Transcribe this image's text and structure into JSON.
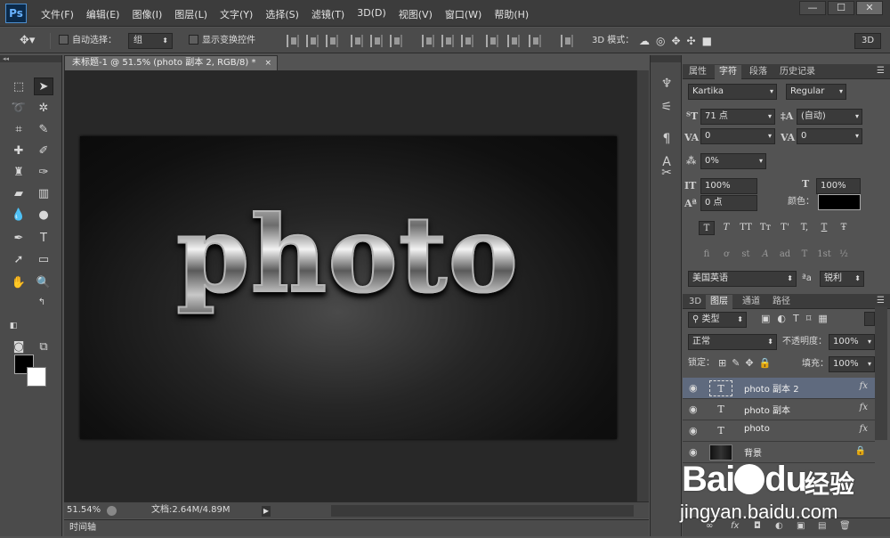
{
  "app": {
    "logo": "Ps",
    "menus": [
      "文件(F)",
      "编辑(E)",
      "图像(I)",
      "图层(L)",
      "文字(Y)",
      "选择(S)",
      "滤镜(T)",
      "3D(D)",
      "视图(V)",
      "窗口(W)",
      "帮助(H)"
    ],
    "window_controls": [
      "—",
      "☐",
      "✕"
    ]
  },
  "options_bar": {
    "auto_select_label": "自动选择：",
    "auto_select_value": "组",
    "show_transform_label": "显示变换控件",
    "mode_3d_label": "3D 模式：",
    "btn_3d": "3D"
  },
  "document": {
    "tab_title": "未标题-1 @ 51.5% (photo 副本 2, RGB/8) *",
    "close": "×",
    "canvas_text": "photo",
    "zoom": "51.54%",
    "doc_info": "文档:2.64M/4.89M",
    "status_arrow": "▶",
    "timeline_label": "时间轴"
  },
  "character_panel": {
    "tabs": [
      "属性",
      "字符",
      "段落",
      "历史记录"
    ],
    "active_tab": "字符",
    "font_family": "Kartika",
    "font_style": "Regular",
    "font_size": "71 点",
    "leading": "(自动)",
    "kerning": "0",
    "tracking": "0",
    "tsume": "0%",
    "vertical_scale": "100%",
    "horizontal_scale": "100%",
    "baseline_shift": "0 点",
    "color_label": "颜色：",
    "color_value": "#000000",
    "style_buttons": [
      "T",
      "T",
      "TT",
      "Tт",
      "T'",
      "T,",
      "T",
      "Ŧ"
    ],
    "opentype_buttons": [
      "fi",
      "ơ",
      "st",
      "A",
      "ad",
      "T",
      "1st",
      "½"
    ],
    "language": "美国英语",
    "aa_icon": "ªa",
    "antialias": "锐利"
  },
  "layers_panel": {
    "tabs": [
      "3D",
      "图层",
      "通道",
      "路径"
    ],
    "active_tab": "图层",
    "filter_kind": "类型",
    "blend_mode": "正常",
    "opacity_label": "不透明度：",
    "opacity_value": "100%",
    "lock_label": "锁定：",
    "fill_label": "填充：",
    "fill_value": "100%",
    "layers": [
      {
        "name": "photo 副本 2",
        "type": "T",
        "fx": "fx",
        "selected": true
      },
      {
        "name": "photo 副本",
        "type": "T",
        "fx": "fx",
        "selected": false
      },
      {
        "name": "photo",
        "type": "T",
        "fx": "fx",
        "selected": false
      },
      {
        "name": "背景",
        "type": "image",
        "fx": "",
        "selected": false
      }
    ],
    "footer_buttons": [
      "∞",
      "fx",
      "◘",
      "◐",
      "▣",
      "▤",
      "🗑"
    ]
  },
  "watermark": {
    "brand": "Bai",
    "brand_suffix": "du",
    "product": "经验",
    "url": "jingyan.baidu.com"
  },
  "colors": {
    "accent_selected_layer": "#5f6a7e",
    "panel_bg": "#535353",
    "canvas_bg": "#282828"
  }
}
